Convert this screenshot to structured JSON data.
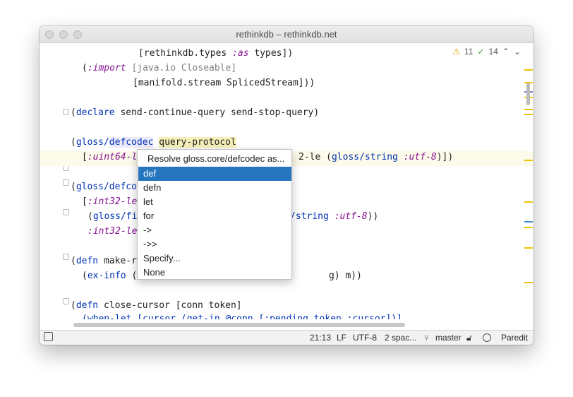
{
  "window": {
    "title": "rethinkdb – rethinkdb.net"
  },
  "inspections": {
    "warnings": "11",
    "weak_warnings": "14",
    "warn_icon": "warning-triangle",
    "ok_icon": "check-mark"
  },
  "code": {
    "l1": {
      "a": "[rethinkdb.types ",
      "b": ":as",
      "c": " types])"
    },
    "l2": {
      "a": "(",
      "b": ":import",
      "c": " [java.io Closeable]"
    },
    "l3": {
      "a": "[manifold.stream SplicedStream]))"
    },
    "l4": {
      "a": "(",
      "b": "declare",
      "c": " send-continue-query send-stop-query)"
    },
    "l5": {
      "a": "(",
      "b": "gloss/",
      "c": "defcodec",
      "d": " ",
      "e": "query-protocol"
    },
    "l6": {
      "a": "[",
      "b": ":uint64-l",
      "c": "2-le (",
      "d": "gloss/string",
      "e": " ",
      "f": ":utf-8",
      "g": ")])"
    },
    "l7": {
      "a": "(",
      "b": "gloss/defco"
    },
    "l8": {
      "a": "[",
      "b": ":int32-le"
    },
    "l9": {
      "a": "(",
      "b": "gloss/fi",
      "c": "/string ",
      "d": ":utf-8",
      "e": "))"
    },
    "l10": {
      "a": ":int32-le"
    },
    "l11": {
      "a": "(",
      "b": "defn",
      "c": " make-r"
    },
    "l12": {
      "a": "(",
      "b": "ex-info",
      "c": " (",
      "d": "g) m))"
    },
    "l13": {
      "a": "(",
      "b": "defn",
      "c": " close-cursor [conn token]"
    },
    "l14": {
      "a": "(when-let [cursor (get-in @conn [:pending token :cursor])]"
    }
  },
  "popup": {
    "title": "Resolve gloss.core/defcodec as...",
    "items": [
      "def",
      "defn",
      "let",
      "for",
      "->",
      "->>",
      "Specify...",
      "None"
    ],
    "selected": "def"
  },
  "status": {
    "position": "21:13",
    "line_ending": "LF",
    "encoding": "UTF-8",
    "indent": "2 spac...",
    "branch": "master",
    "mode": "Paredit"
  },
  "colors": {
    "keyword": "#0033b3",
    "keyword_literal": "#871094",
    "selection": "#2675bf",
    "warning_marker": "#f0c300",
    "current_line": "#fcfae9"
  }
}
